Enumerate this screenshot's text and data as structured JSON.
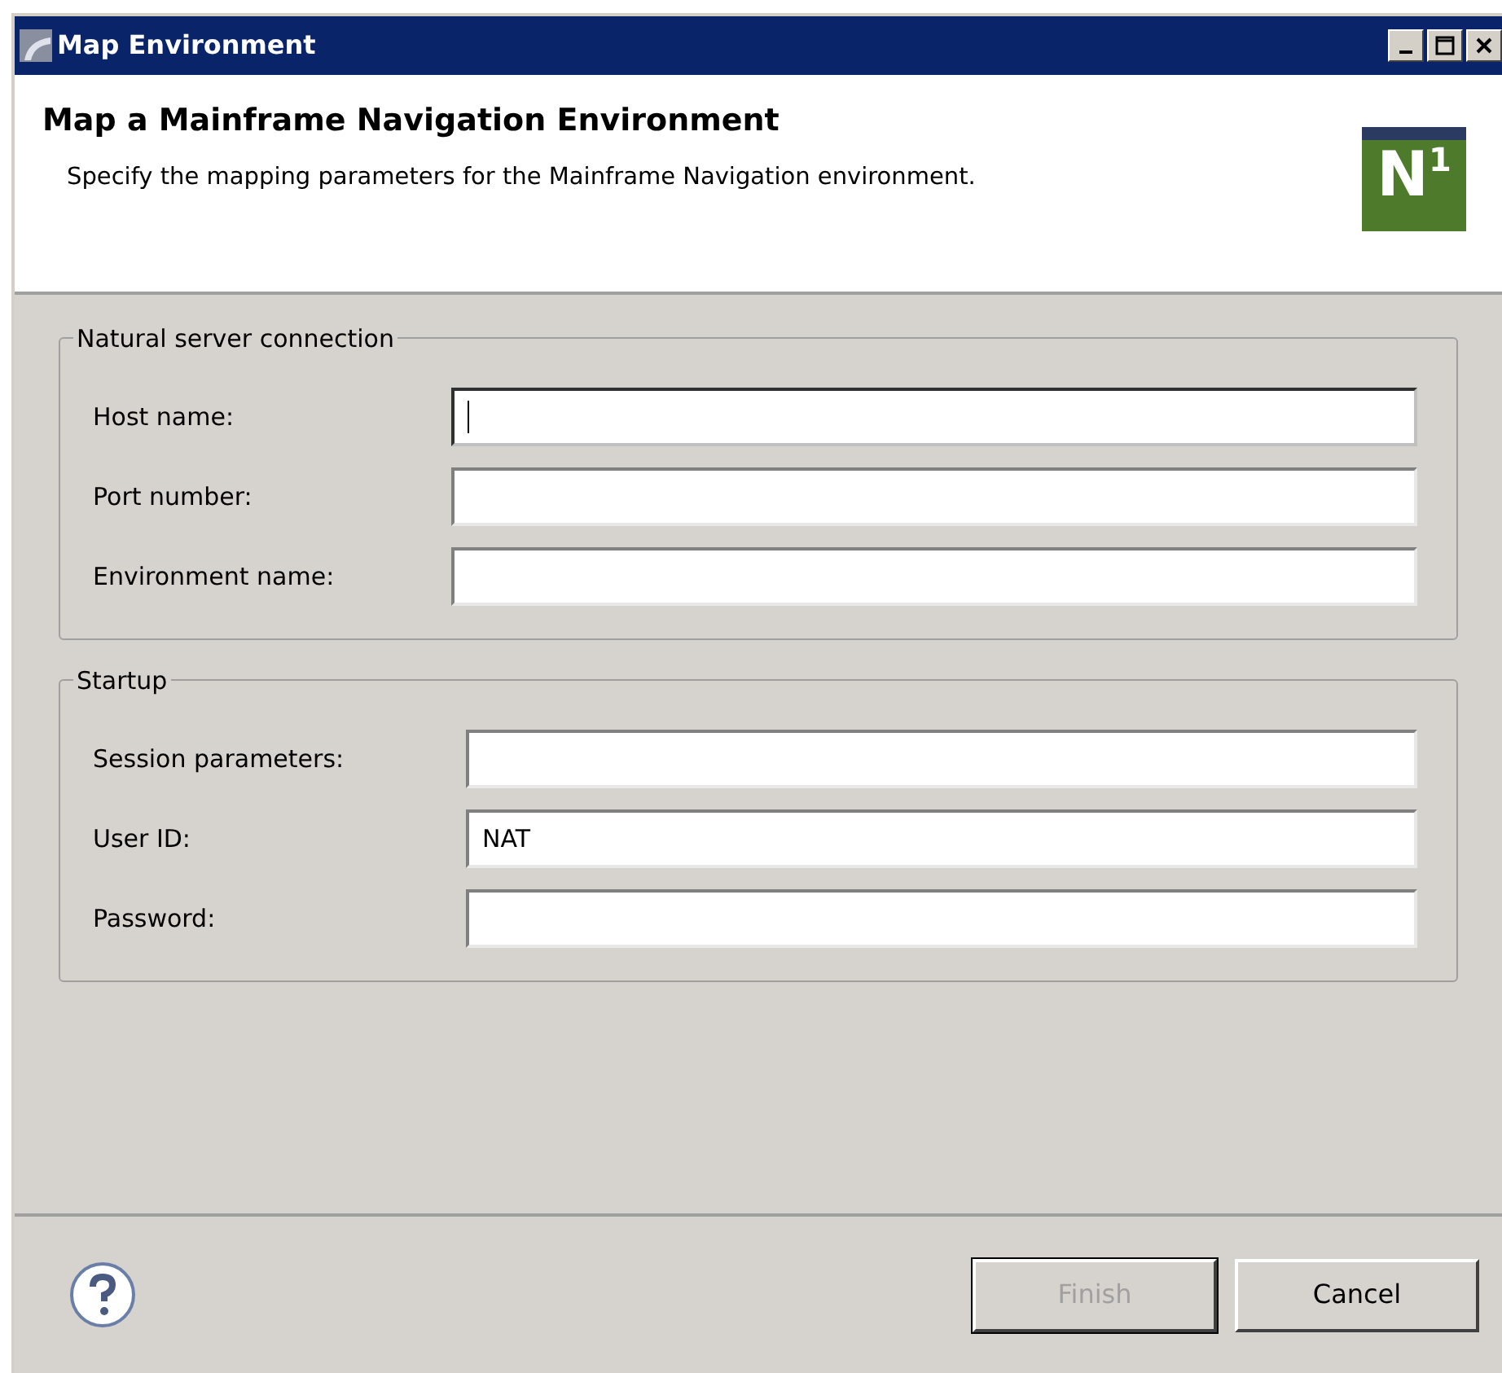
{
  "window": {
    "title": "Map Environment"
  },
  "header": {
    "title": "Map a Mainframe Navigation Environment",
    "description": "Specify the mapping parameters for the Mainframe Navigation environment.",
    "logo": {
      "letter": "N",
      "superscript": "1"
    }
  },
  "groups": [
    {
      "title": "Natural server connection",
      "fields": [
        {
          "label": "Host name:",
          "focused": true
        },
        {
          "label": "Port number:",
          "focused": false
        },
        {
          "label": "Environment name:",
          "focused": false
        }
      ]
    },
    {
      "title": "Startup",
      "fields": [
        {
          "label": "Session parameters:",
          "focused": false
        },
        {
          "label": "User ID:",
          "value": "NAT",
          "focused": false
        },
        {
          "label": "Password:",
          "focused": false
        }
      ]
    }
  ],
  "buttons": [
    {
      "label": "Finish",
      "disabled": true
    },
    {
      "label": "Cancel",
      "disabled": false
    }
  ]
}
